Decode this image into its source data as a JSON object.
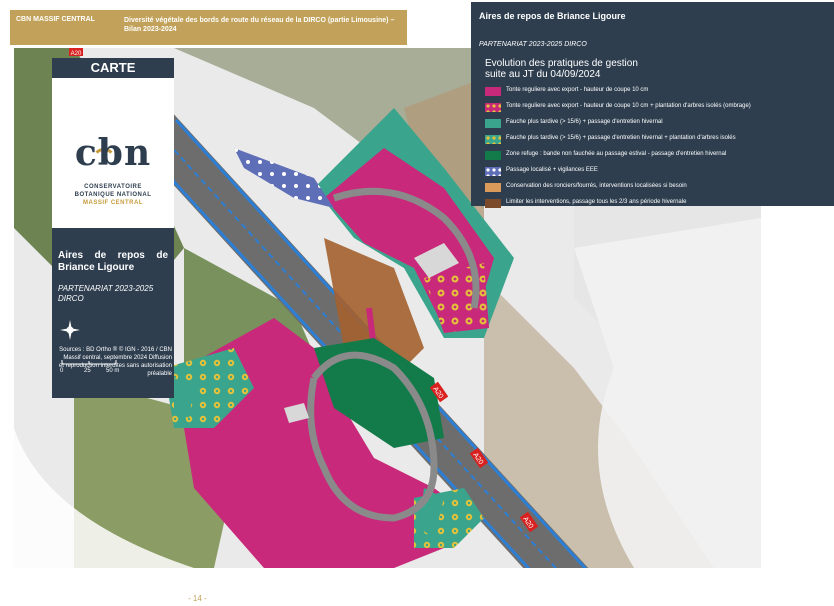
{
  "header": {
    "org": "CBN MASSIF CENTRAL",
    "report_title": "Diversité végétale des bords de route du réseau de la DIRCO (partie Limousine) – Bilan 2023-2024"
  },
  "carte_panel": {
    "title": "CARTE",
    "logo": {
      "text": "cbn",
      "line1": "CONSERVATOIRE",
      "line2": "BOTANIQUE NATIONAL",
      "line3": "MASSIF CENTRAL"
    },
    "site_title": "Aires de repos de Briance Ligoure",
    "partnership": "PARTENARIAT 2023-2025 DIRCO",
    "scale": {
      "labels": [
        "0",
        "25",
        "50 m"
      ]
    },
    "sources": "Sources : BD Ortho ® © IGN - 2016 / CBN Massif central, septembre 2024 Diffusion et reproduction interdites sans autorisation préalable"
  },
  "legend": {
    "title": "Aires de repos de Briance Ligoure",
    "partnership": "PARTENARIAT 2023-2025 DIRCO",
    "heading_line1": "Evolution des pratiques de gestion",
    "heading_line2": "suite au JT du 04/09/2024",
    "items": [
      {
        "label": "Tonte reguliere avec export - hauteur de coupe 10 cm",
        "color": "#c8297a",
        "pattern": "solid"
      },
      {
        "label": "Tonte reguliere avec export - hauteur de coupe 10 cm + plantation d'arbres isolés (ombrage)",
        "color": "#c8297a",
        "pattern": "dots",
        "dot_color": "#e3c13a"
      },
      {
        "label": "Fauche plus tardive (> 15/6) + passage d'entretien hivernal",
        "color": "#3aa58c",
        "pattern": "solid"
      },
      {
        "label": "Fauche plus tardive (> 15/6) + passage d'entretien hivernal + plantation d'arbres isolés",
        "color": "#3aa58c",
        "pattern": "dots",
        "dot_color": "#e3c13a"
      },
      {
        "label": "Zone refuge : bande non fauchée au passage estival - passage d'entretien hivernal",
        "color": "#137a4a",
        "pattern": "solid"
      },
      {
        "label": "Passage localisé + vigilances EEE",
        "color": "#5e6fb8",
        "pattern": "dots",
        "dot_color": "#ffffff"
      },
      {
        "label": "Conservation des ronciers/fourrés, interventions localisées si besoin",
        "color": "#d99a5a",
        "pattern": "solid"
      },
      {
        "label": "Limiter les interventions, passage tous les 2/3 ans période hivernale",
        "color": "#7a4a2a",
        "pattern": "solid"
      }
    ]
  },
  "map": {
    "road_labels": [
      "A20",
      "A20",
      "A20",
      "A20"
    ]
  },
  "footer": {
    "page_number": "- 14 -"
  }
}
